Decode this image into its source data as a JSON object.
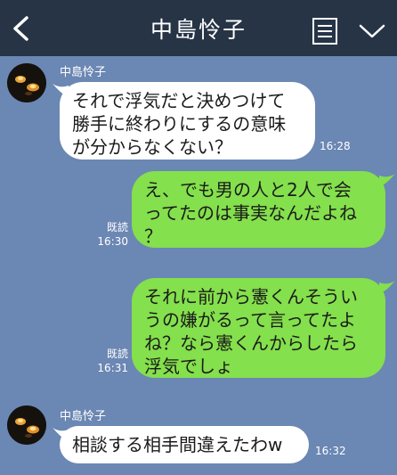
{
  "header": {
    "title": "中島怜子"
  },
  "messages": [
    {
      "sender": "中島怜子",
      "lines": [
        "それで浮気だと決めつけて",
        "勝手に終わりにするの意味",
        "が分からなくない？"
      ],
      "time": "16:28"
    },
    {
      "lines": [
        "え、でも男の人と2人で会",
        "ってたのは事実なんだよね",
        "？"
      ],
      "read": "既読",
      "time": "16:30"
    },
    {
      "lines": [
        "それに前から憲くんそうい",
        "うの嫌がるって言ってたよ",
        "ね？なら憲くんからしたら",
        "浮気でしょ"
      ],
      "read": "既読",
      "time": "16:31"
    },
    {
      "sender": "中島怜子",
      "lines": [
        "相談する相手間違えたわw"
      ],
      "time": "16:32"
    }
  ],
  "colors": {
    "background": "#6b87b3",
    "header": "#263446",
    "outgoing_bubble": "#84e04c",
    "incoming_bubble": "#ffffff"
  },
  "icons": [
    "back-chevron-icon",
    "menu-list-icon",
    "chevron-down-icon"
  ]
}
